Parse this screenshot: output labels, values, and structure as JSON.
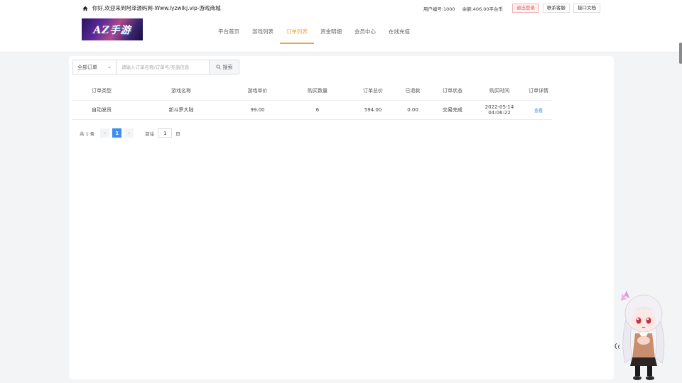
{
  "header": {
    "welcome": "你好,欢迎来到阿泽源码网-Www.lyzwlkj.vip-游戏商城",
    "user_id": "用户编号:1000",
    "balance": "余额:406.00平台币",
    "logout_label": "退出登录",
    "support_label": "联系客服",
    "api_docs_label": "接口文档",
    "logo_text": "AZ手游"
  },
  "nav": {
    "items": [
      {
        "label": "平台首页"
      },
      {
        "label": "游戏列表"
      },
      {
        "label": "订单列表"
      },
      {
        "label": "资金明细"
      },
      {
        "label": "会员中心"
      },
      {
        "label": "在线充值"
      }
    ],
    "active": "订单列表"
  },
  "search": {
    "select_value": "全部订单",
    "placeholder": "请输入订单名称/订单号/充值信息",
    "button_label": "搜索"
  },
  "table": {
    "columns": [
      "订单类型",
      "游戏名称",
      "游戏单价",
      "购买数量",
      "订单总价",
      "已退款",
      "订单状态",
      "购买时间",
      "订单详情"
    ],
    "rows": [
      [
        "自动发货",
        "新斗罗大陆",
        "99.00",
        "6",
        "594.00",
        "0.00",
        "交易完成",
        "2022-05-14 04:06:22",
        "查看"
      ]
    ]
  },
  "pagination": {
    "total": "共 1 条",
    "current": "1",
    "goto_label": "前往",
    "goto_value": "1",
    "page_suffix": "页"
  },
  "colors": {
    "accent": "#f0a63a",
    "primary": "#3d8ef0",
    "danger": "#e35a5a"
  }
}
